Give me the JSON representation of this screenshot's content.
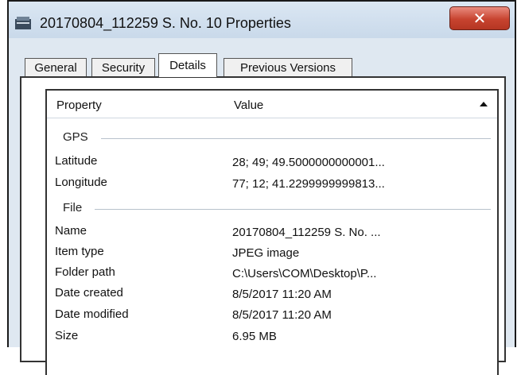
{
  "window": {
    "title": "20170804_112259 S. No. 10 Properties",
    "close_glyph": "✕"
  },
  "tabs": [
    {
      "label": "General"
    },
    {
      "label": "Security"
    },
    {
      "label": "Details"
    },
    {
      "label": "Previous Versions"
    }
  ],
  "active_tab": "Details",
  "list": {
    "col_property": "Property",
    "col_value": "Value",
    "groups": [
      {
        "name": "GPS"
      },
      {
        "name": "File"
      }
    ],
    "rows": [
      {
        "property": "Latitude",
        "value": "28; 49; 49.5000000000001..."
      },
      {
        "property": "Longitude",
        "value": "77; 12; 41.2299999999813..."
      },
      {
        "property": "Name",
        "value": "20170804_112259 S. No. ..."
      },
      {
        "property": "Item type",
        "value": "JPEG image"
      },
      {
        "property": "Folder path",
        "value": "C:\\Users\\COM\\Desktop\\P..."
      },
      {
        "property": "Date created",
        "value": "8/5/2017 11:20 AM"
      },
      {
        "property": "Date modified",
        "value": "8/5/2017 11:20 AM"
      },
      {
        "property": "Size",
        "value": "6.95 MB"
      }
    ]
  },
  "icons": {
    "app": "folder-properties-icon",
    "sort": "sort-ascending-icon"
  }
}
